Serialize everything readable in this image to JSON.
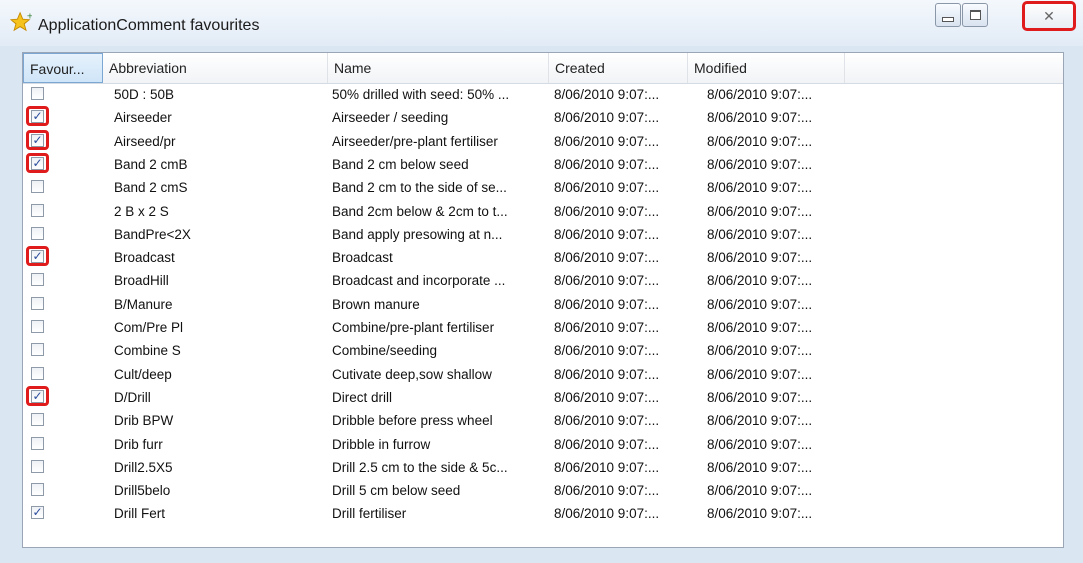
{
  "window": {
    "title": "ApplicationComment favourites",
    "icon": "star-icon",
    "close_symbol": "✕"
  },
  "columns": [
    "Favour...",
    "Abbreviation",
    "Name",
    "Created",
    "Modified"
  ],
  "rows": [
    {
      "checked": false,
      "highlighted": false,
      "abbreviation": "50D : 50B",
      "name": "50% drilled with seed: 50% ...",
      "created": "8/06/2010 9:07:...",
      "modified": "8/06/2010 9:07:..."
    },
    {
      "checked": true,
      "highlighted": true,
      "abbreviation": "Airseeder",
      "name": "Airseeder / seeding",
      "created": "8/06/2010 9:07:...",
      "modified": "8/06/2010 9:07:..."
    },
    {
      "checked": true,
      "highlighted": true,
      "abbreviation": "Airseed/pr",
      "name": "Airseeder/pre-plant fertiliser",
      "created": "8/06/2010 9:07:...",
      "modified": "8/06/2010 9:07:..."
    },
    {
      "checked": true,
      "highlighted": true,
      "abbreviation": "Band 2 cmB",
      "name": "Band 2 cm below seed",
      "created": "8/06/2010 9:07:...",
      "modified": "8/06/2010 9:07:..."
    },
    {
      "checked": false,
      "highlighted": false,
      "abbreviation": "Band 2 cmS",
      "name": "Band 2 cm to the side of se...",
      "created": "8/06/2010 9:07:...",
      "modified": "8/06/2010 9:07:..."
    },
    {
      "checked": false,
      "highlighted": false,
      "abbreviation": "2 B x 2 S",
      "name": "Band 2cm below & 2cm to t...",
      "created": "8/06/2010 9:07:...",
      "modified": "8/06/2010 9:07:..."
    },
    {
      "checked": false,
      "highlighted": false,
      "abbreviation": "BandPre<2X",
      "name": "Band apply presowing at n...",
      "created": "8/06/2010 9:07:...",
      "modified": "8/06/2010 9:07:..."
    },
    {
      "checked": true,
      "highlighted": true,
      "abbreviation": "Broadcast",
      "name": "Broadcast",
      "created": "8/06/2010 9:07:...",
      "modified": "8/06/2010 9:07:..."
    },
    {
      "checked": false,
      "highlighted": false,
      "abbreviation": "BroadHill",
      "name": "Broadcast and incorporate ...",
      "created": "8/06/2010 9:07:...",
      "modified": "8/06/2010 9:07:..."
    },
    {
      "checked": false,
      "highlighted": false,
      "abbreviation": "B/Manure",
      "name": "Brown manure",
      "created": "8/06/2010 9:07:...",
      "modified": "8/06/2010 9:07:..."
    },
    {
      "checked": false,
      "highlighted": false,
      "abbreviation": "Com/Pre Pl",
      "name": "Combine/pre-plant fertiliser",
      "created": "8/06/2010 9:07:...",
      "modified": "8/06/2010 9:07:..."
    },
    {
      "checked": false,
      "highlighted": false,
      "abbreviation": "Combine S",
      "name": "Combine/seeding",
      "created": "8/06/2010 9:07:...",
      "modified": "8/06/2010 9:07:..."
    },
    {
      "checked": false,
      "highlighted": false,
      "abbreviation": "Cult/deep",
      "name": "Cutivate deep,sow shallow",
      "created": "8/06/2010 9:07:...",
      "modified": "8/06/2010 9:07:..."
    },
    {
      "checked": true,
      "highlighted": true,
      "abbreviation": "D/Drill",
      "name": "Direct drill",
      "created": "8/06/2010 9:07:...",
      "modified": "8/06/2010 9:07:..."
    },
    {
      "checked": false,
      "highlighted": false,
      "abbreviation": "Drib BPW",
      "name": "Dribble before press wheel",
      "created": "8/06/2010 9:07:...",
      "modified": "8/06/2010 9:07:..."
    },
    {
      "checked": false,
      "highlighted": false,
      "abbreviation": "Drib furr",
      "name": "Dribble in furrow",
      "created": "8/06/2010 9:07:...",
      "modified": "8/06/2010 9:07:..."
    },
    {
      "checked": false,
      "highlighted": false,
      "abbreviation": "Drill2.5X5",
      "name": "Drill 2.5 cm to the side & 5c...",
      "created": "8/06/2010 9:07:...",
      "modified": "8/06/2010 9:07:..."
    },
    {
      "checked": false,
      "highlighted": false,
      "abbreviation": "Drill5belo",
      "name": "Drill 5 cm below seed",
      "created": "8/06/2010 9:07:...",
      "modified": "8/06/2010 9:07:..."
    },
    {
      "checked": true,
      "highlighted": false,
      "abbreviation": "Drill Fert",
      "name": "Drill fertiliser",
      "created": "8/06/2010 9:07:...",
      "modified": "8/06/2010 9:07:..."
    }
  ],
  "scrollbar": {
    "up_icon": "chevron-up-icon",
    "down_icon": "chevron-down-icon"
  },
  "colors": {
    "highlight": "#e01b1b",
    "check": "#2b4c9c"
  }
}
